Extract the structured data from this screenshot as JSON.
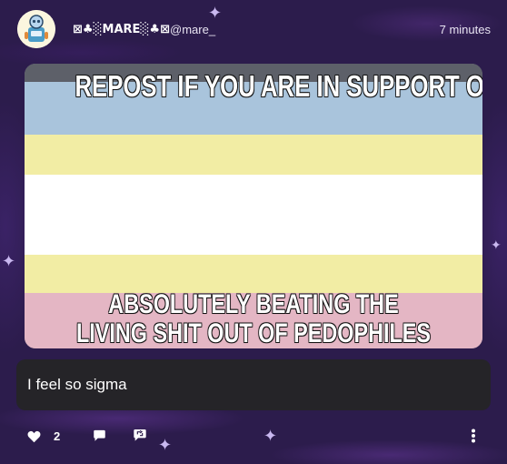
{
  "post": {
    "author_name": "⊠♣░MARE░♣⊠",
    "author_handle": "@mare_",
    "timestamp": "7 minutes",
    "avatar_icon": "robot-avatar-icon",
    "media": {
      "top_text": "REPOST IF YOU ARE IN SUPPORT OF",
      "bottom_text_line1": "ABSOLUTELY BEATING THE",
      "bottom_text_line2": "LIVING SHIT OUT OF PEDOPHILES",
      "flag_colors": [
        "#a9c4dc",
        "#f5f0a6",
        "#ffffff",
        "#f5f0a6",
        "#e4b6c4"
      ]
    },
    "caption": "I feel so sigma"
  },
  "actions": {
    "like_icon": "heart-icon",
    "like_count": "2",
    "comment_icon": "comment-icon",
    "repost_icon": "repost-icon",
    "more_icon": "more-options-icon"
  },
  "colors": {
    "background": "#2c1c4c",
    "caption_box": "#252428"
  }
}
